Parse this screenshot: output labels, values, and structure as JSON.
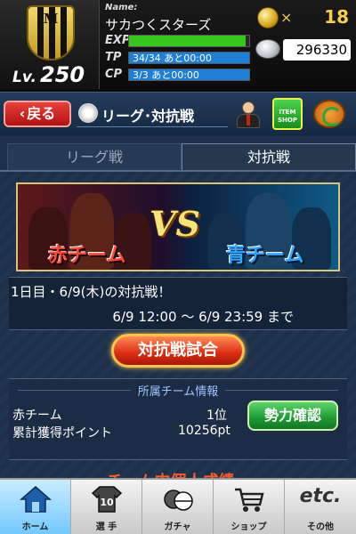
{
  "header": {
    "badge_letter": "M",
    "level_prefix": "Lv.",
    "level": "250",
    "name_label": "Name:",
    "team_name": "サカつくスターズ",
    "exp_label": "EXP",
    "tp_label": "TP",
    "tp_text": "34/34 あと00:00",
    "tp_fill": 1.0,
    "cp_label": "CP",
    "cp_text": "3/3 あと00:00",
    "cp_fill": 1.0,
    "exp_fill": 0.97,
    "coin_x": "×",
    "coin_count": "18",
    "money": "296330"
  },
  "title_bar": {
    "back_label": "戻る",
    "back_arrow": "‹",
    "title": "リーグ･対抗戦",
    "shop_text": "ITEM SHOP"
  },
  "tabs": [
    {
      "label": "リーグ戦",
      "active": false
    },
    {
      "label": "対抗戦",
      "active": true
    }
  ],
  "banner": {
    "vs": "VS",
    "red_team": "赤チーム",
    "blue_team": "青チーム"
  },
  "schedule": {
    "day_text": "1日目・6/9(木)の対抗戦！",
    "time_text": "6/9 12:00 〜 6/9 23:59 まで"
  },
  "match_button": "対抗戦試合",
  "team_info": {
    "title": "所属チーム情報",
    "team_label": "赤チーム",
    "rank": "1位",
    "points_label": "累計獲得ポイント",
    "points": "10256pt",
    "power_button": "勢力確認"
  },
  "next_section_title": "チーム内個人成績",
  "bottom_nav": [
    {
      "label": "ホーム",
      "icon": "home-icon",
      "active": true
    },
    {
      "label": "選 手",
      "icon": "jersey-icon",
      "number": "10",
      "active": false
    },
    {
      "label": "ガチャ",
      "icon": "gacha-icon",
      "active": false
    },
    {
      "label": "ショップ",
      "icon": "cart-icon",
      "active": false
    },
    {
      "label": "その他",
      "icon": "etc-icon",
      "etc": "etc.",
      "active": false
    }
  ],
  "colors": {
    "exp_bar": "#36c61c",
    "tp_bar": "#1f7fd6",
    "cp_bar": "#1f7fd6",
    "back_button": "#c81a16",
    "match_button": "#e0381c",
    "power_button": "#24a93a"
  }
}
